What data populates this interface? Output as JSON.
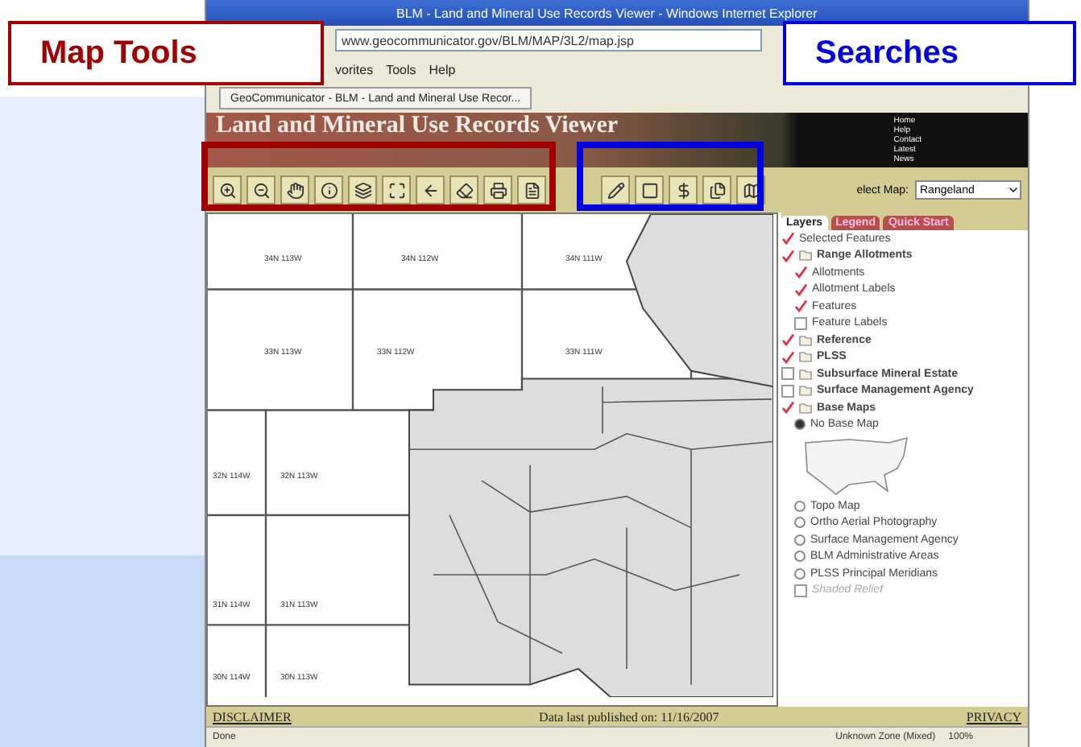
{
  "callouts": [
    {
      "label": "Map Tools",
      "color": "#a00000"
    },
    {
      "label": "Searches",
      "color": "#0000e0"
    }
  ],
  "browser": {
    "title": "BLM - Land and Mineral Use Records Viewer - Windows Internet Explorer",
    "address": "www.geocommunicator.gov/BLM/MAP/3L2/map.jsp",
    "menu": [
      "vorites",
      "Tools",
      "Help"
    ],
    "tab": "GeoCommunicator - BLM - Land and Mineral Use Recor..."
  },
  "banner": {
    "title": "Land and Mineral Use Records Viewer",
    "links": [
      "Home",
      "Help",
      "Contact",
      "Latest",
      "News"
    ],
    "select_label": "elect Map:",
    "select_value": "Rangeland"
  },
  "map": {
    "labels": [
      "34N 113W",
      "34N 112W",
      "34N 111W",
      "33N 113W",
      "33N 112W",
      "33N 111W",
      "32N 114W",
      "32N 113W",
      "31N 114W",
      "31N 113W",
      "30N 114W",
      "30N 113W"
    ]
  },
  "panel": {
    "tabs": [
      {
        "label": "Layers",
        "selected": true
      },
      {
        "label": "Legend",
        "selected": false
      },
      {
        "label": "Quick Start",
        "selected": false
      }
    ],
    "layers": [
      {
        "label": "Selected Features",
        "checked": true,
        "kind": "item"
      },
      {
        "label": "Range Allotments",
        "checked": true,
        "kind": "group",
        "children": [
          {
            "label": "Allotments",
            "checked": true,
            "kind": "item"
          },
          {
            "label": "Allotment Labels",
            "checked": true,
            "kind": "item"
          },
          {
            "label": "Features",
            "checked": true,
            "kind": "item"
          },
          {
            "label": "Feature Labels",
            "checked": false,
            "kind": "item"
          }
        ]
      },
      {
        "label": "Reference",
        "checked": true,
        "kind": "group"
      },
      {
        "label": "PLSS",
        "checked": true,
        "kind": "group"
      },
      {
        "label": "Subsurface Mineral Estate",
        "checked": false,
        "kind": "group"
      },
      {
        "label": "Surface Management Agency",
        "checked": false,
        "kind": "group"
      },
      {
        "label": "Base Maps",
        "checked": true,
        "kind": "group"
      }
    ],
    "base_maps": [
      {
        "label": "No Base Map",
        "selected": true
      },
      {
        "label": "Topo Map",
        "selected": false
      },
      {
        "label": "Ortho Aerial Photography",
        "selected": false
      },
      {
        "label": "Surface Management Agency",
        "selected": false
      },
      {
        "label": "BLM Administrative Areas",
        "selected": false
      },
      {
        "label": "PLSS Principal Meridians",
        "selected": false
      }
    ],
    "shaded_relief": {
      "label": "Shaded Relief",
      "checked": false,
      "disabled": true
    }
  },
  "footer": {
    "left": "DISCLAIMER",
    "center": "Data last published on: 11/16/2007",
    "right": "PRIVACY"
  },
  "status_bar": {
    "status": "Done",
    "zone": "Unknown Zone (Mixed)",
    "zoom": "100%"
  }
}
